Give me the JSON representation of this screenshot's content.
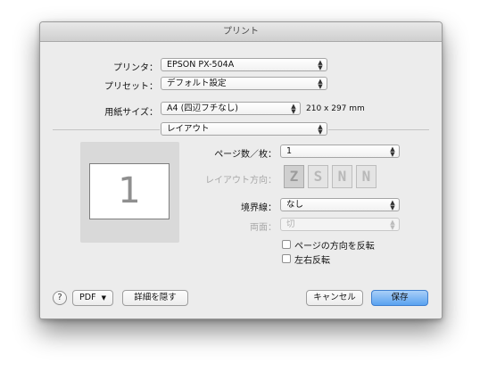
{
  "window": {
    "title": "プリント"
  },
  "printer": {
    "label": "プリンタ：",
    "value": "EPSON PX-504A"
  },
  "preset": {
    "label": "プリセット：",
    "value": "デフォルト設定"
  },
  "paper_size": {
    "label": "用紙サイズ：",
    "value": "A4 (四辺フチなし)",
    "dimensions": "210 x 297 mm"
  },
  "section_menu": {
    "value": "レイアウト"
  },
  "preview": {
    "page_number": "1"
  },
  "pages_per_sheet": {
    "label": "ページ数／枚：",
    "value": "1"
  },
  "layout_direction": {
    "label": "レイアウト方向：",
    "options": [
      "Z",
      "S",
      "N",
      "N"
    ]
  },
  "border": {
    "label": "境界線：",
    "value": "なし"
  },
  "two_sided": {
    "label": "両面：",
    "value": "切"
  },
  "reverse_orientation": {
    "label": "ページの方向を反転",
    "checked": false
  },
  "flip_horizontal": {
    "label": "左右反転",
    "checked": false
  },
  "footer": {
    "help_label": "?",
    "pdf_label": "PDF",
    "pdf_arrow": "▼",
    "hide_details_label": "詳細を隠す",
    "cancel_label": "キャンセル",
    "print_label": "保存"
  },
  "colors": {
    "accent": "#5aa2f0",
    "dialog_bg": "#ececec",
    "preview_bg": "#d9d9d9"
  }
}
